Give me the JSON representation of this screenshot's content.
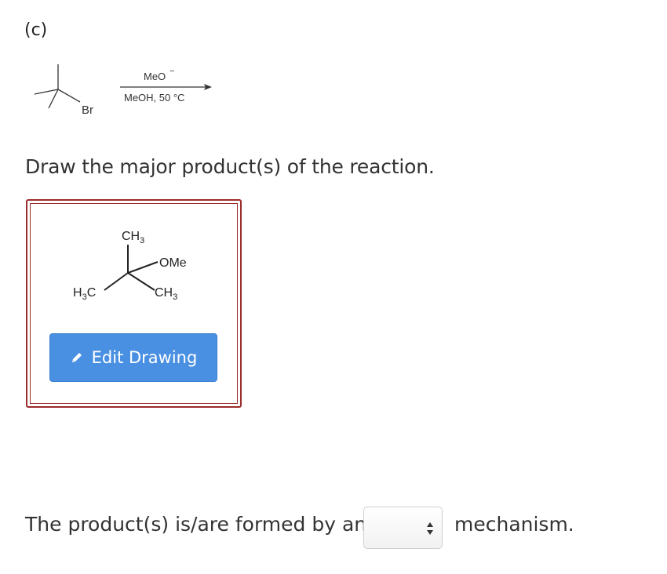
{
  "question": {
    "part_label": "(c)",
    "reaction": {
      "substrate_leaving_group": "Br",
      "reagent_top": "MeO",
      "reagent_charge": "−",
      "reagent_bottom": "MeOH, 50 °C"
    },
    "prompt": "Draw the major product(s) of the reaction."
  },
  "answer": {
    "product_labels": {
      "top": "CH3",
      "right": "OMe",
      "left": "H3C",
      "bottom": "CH3"
    },
    "edit_button_label": "Edit Drawing",
    "edit_button_icon": "pencil-icon"
  },
  "mechanism_question": {
    "text_before": "The product(s) is/are formed by an",
    "select_value": "",
    "text_after": "mechanism."
  },
  "colors": {
    "button_blue": "#4a90e2",
    "answer_border": "#9b2c2c"
  }
}
